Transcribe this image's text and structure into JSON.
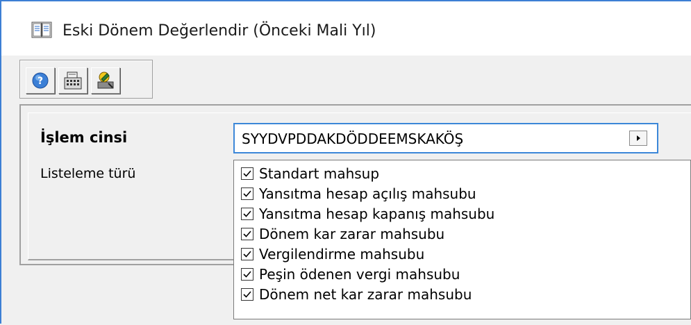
{
  "window": {
    "title": "Eski Dönem Değerlendir (Önceki Mali Yıl)",
    "icon": "book-icon"
  },
  "toolbar": {
    "buttons": [
      {
        "name": "help-button",
        "icon": "help-icon"
      },
      {
        "name": "calculator-button",
        "icon": "calculator-icon"
      },
      {
        "name": "run-button",
        "icon": "run-icon"
      }
    ]
  },
  "form": {
    "islem_cinsi_label": "İşlem cinsi",
    "listeleme_turu_label": "Listeleme türü",
    "islem_cinsi_value": "SYYDVPDDAKDÖDDEEMSKAKÖŞ"
  },
  "checklist": {
    "items": [
      {
        "label": "Standart mahsup",
        "checked": true
      },
      {
        "label": "Yansıtma hesap açılış mahsubu",
        "checked": true
      },
      {
        "label": "Yansıtma hesap kapanış mahsubu",
        "checked": true
      },
      {
        "label": "Dönem kar zarar mahsubu",
        "checked": true
      },
      {
        "label": "Vergilendirme mahsubu",
        "checked": true
      },
      {
        "label": "Peşin ödenen vergi mahsubu",
        "checked": true
      },
      {
        "label": "Dönem net kar zarar mahsubu",
        "checked": true
      }
    ]
  },
  "colors": {
    "accent_border": "#3c87d8",
    "window_bg": "#f0f0f0"
  }
}
